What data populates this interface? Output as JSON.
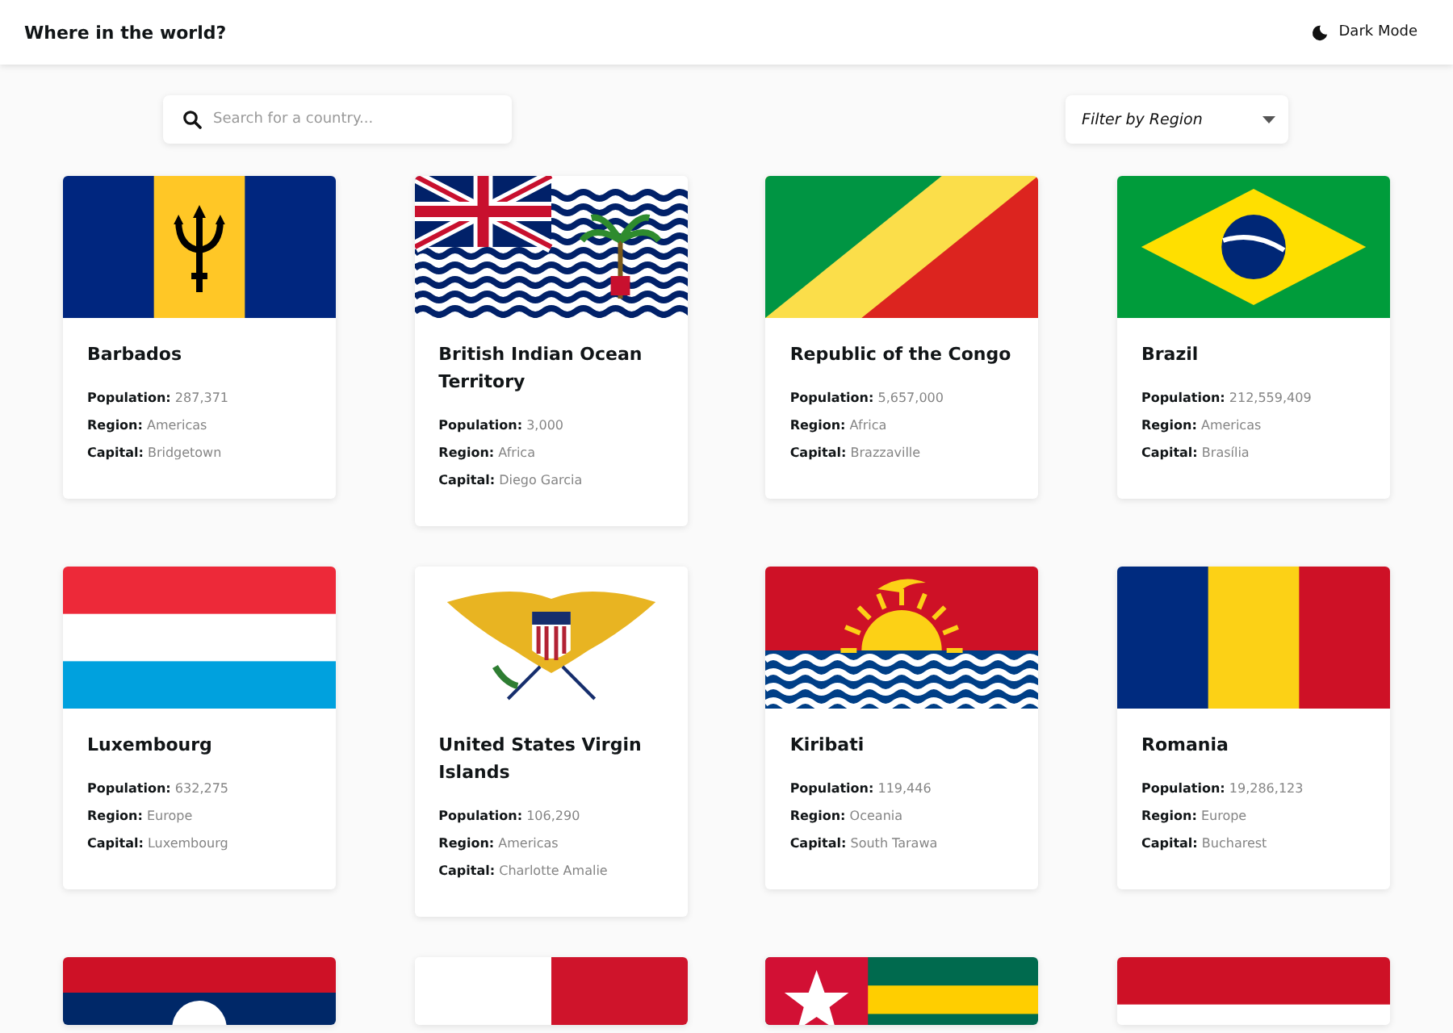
{
  "header": {
    "title": "Where in the world?",
    "theme_toggle": "Dark Mode"
  },
  "search": {
    "placeholder": "Search for a country..."
  },
  "filter": {
    "label": "Filter by Region"
  },
  "countries": [
    {
      "flag": {
        "kind": "vertical-trident"
      },
      "name": "Barbados",
      "fields": [
        {
          "label": "Population:",
          "value": "287,371"
        },
        {
          "label": "Region:",
          "value": "Americas"
        },
        {
          "label": "Capital:",
          "value": "Bridgetown"
        }
      ]
    },
    {
      "flag": {
        "kind": "waves-jack"
      },
      "name": "British Indian Ocean Territory",
      "fields": [
        {
          "label": "Population:",
          "value": "3,000"
        },
        {
          "label": "Region:",
          "value": "Africa"
        },
        {
          "label": "Capital:",
          "value": "Diego Garcia"
        }
      ]
    },
    {
      "flag": {
        "kind": "diagonal"
      },
      "name": "Republic of the Congo",
      "fields": [
        {
          "label": "Population:",
          "value": "5,657,000"
        },
        {
          "label": "Region:",
          "value": "Africa"
        },
        {
          "label": "Capital:",
          "value": "Brazzaville"
        }
      ]
    },
    {
      "flag": {
        "kind": "diamond"
      },
      "name": "Brazil",
      "fields": [
        {
          "label": "Population:",
          "value": "212,559,409"
        },
        {
          "label": "Region:",
          "value": "Americas"
        },
        {
          "label": "Capital:",
          "value": "Brasília"
        }
      ]
    },
    {
      "flag": {
        "kind": "horizontal-light"
      },
      "name": "Luxembourg",
      "fields": [
        {
          "label": "Population:",
          "value": "632,275"
        },
        {
          "label": "Region:",
          "value": "Europe"
        },
        {
          "label": "Capital:",
          "value": "Luxembourg"
        }
      ]
    },
    {
      "flag": {
        "kind": "emblem"
      },
      "name": "United States Virgin Islands",
      "fields": [
        {
          "label": "Population:",
          "value": "106,290"
        },
        {
          "label": "Region:",
          "value": "Americas"
        },
        {
          "label": "Capital:",
          "value": "Charlotte Amalie"
        }
      ]
    },
    {
      "flag": {
        "kind": "sun-waves"
      },
      "name": "Kiribati",
      "fields": [
        {
          "label": "Population:",
          "value": "119,446"
        },
        {
          "label": "Region:",
          "value": "Oceania"
        },
        {
          "label": "Capital:",
          "value": "South Tarawa"
        }
      ]
    },
    {
      "flag": {
        "kind": "vertical-tricolor"
      },
      "name": "Romania",
      "fields": [
        {
          "label": "Population:",
          "value": "19,286,123"
        },
        {
          "label": "Region:",
          "value": "Europe"
        },
        {
          "label": "Capital:",
          "value": "Bucharest"
        }
      ]
    },
    {
      "flag": {
        "kind": "horizontal-disc"
      }
    },
    {
      "flag": {
        "kind": "vertical-bicolor"
      }
    },
    {
      "flag": {
        "kind": "canton-star"
      }
    },
    {
      "flag": {
        "kind": "horizontal-dark"
      }
    }
  ]
}
